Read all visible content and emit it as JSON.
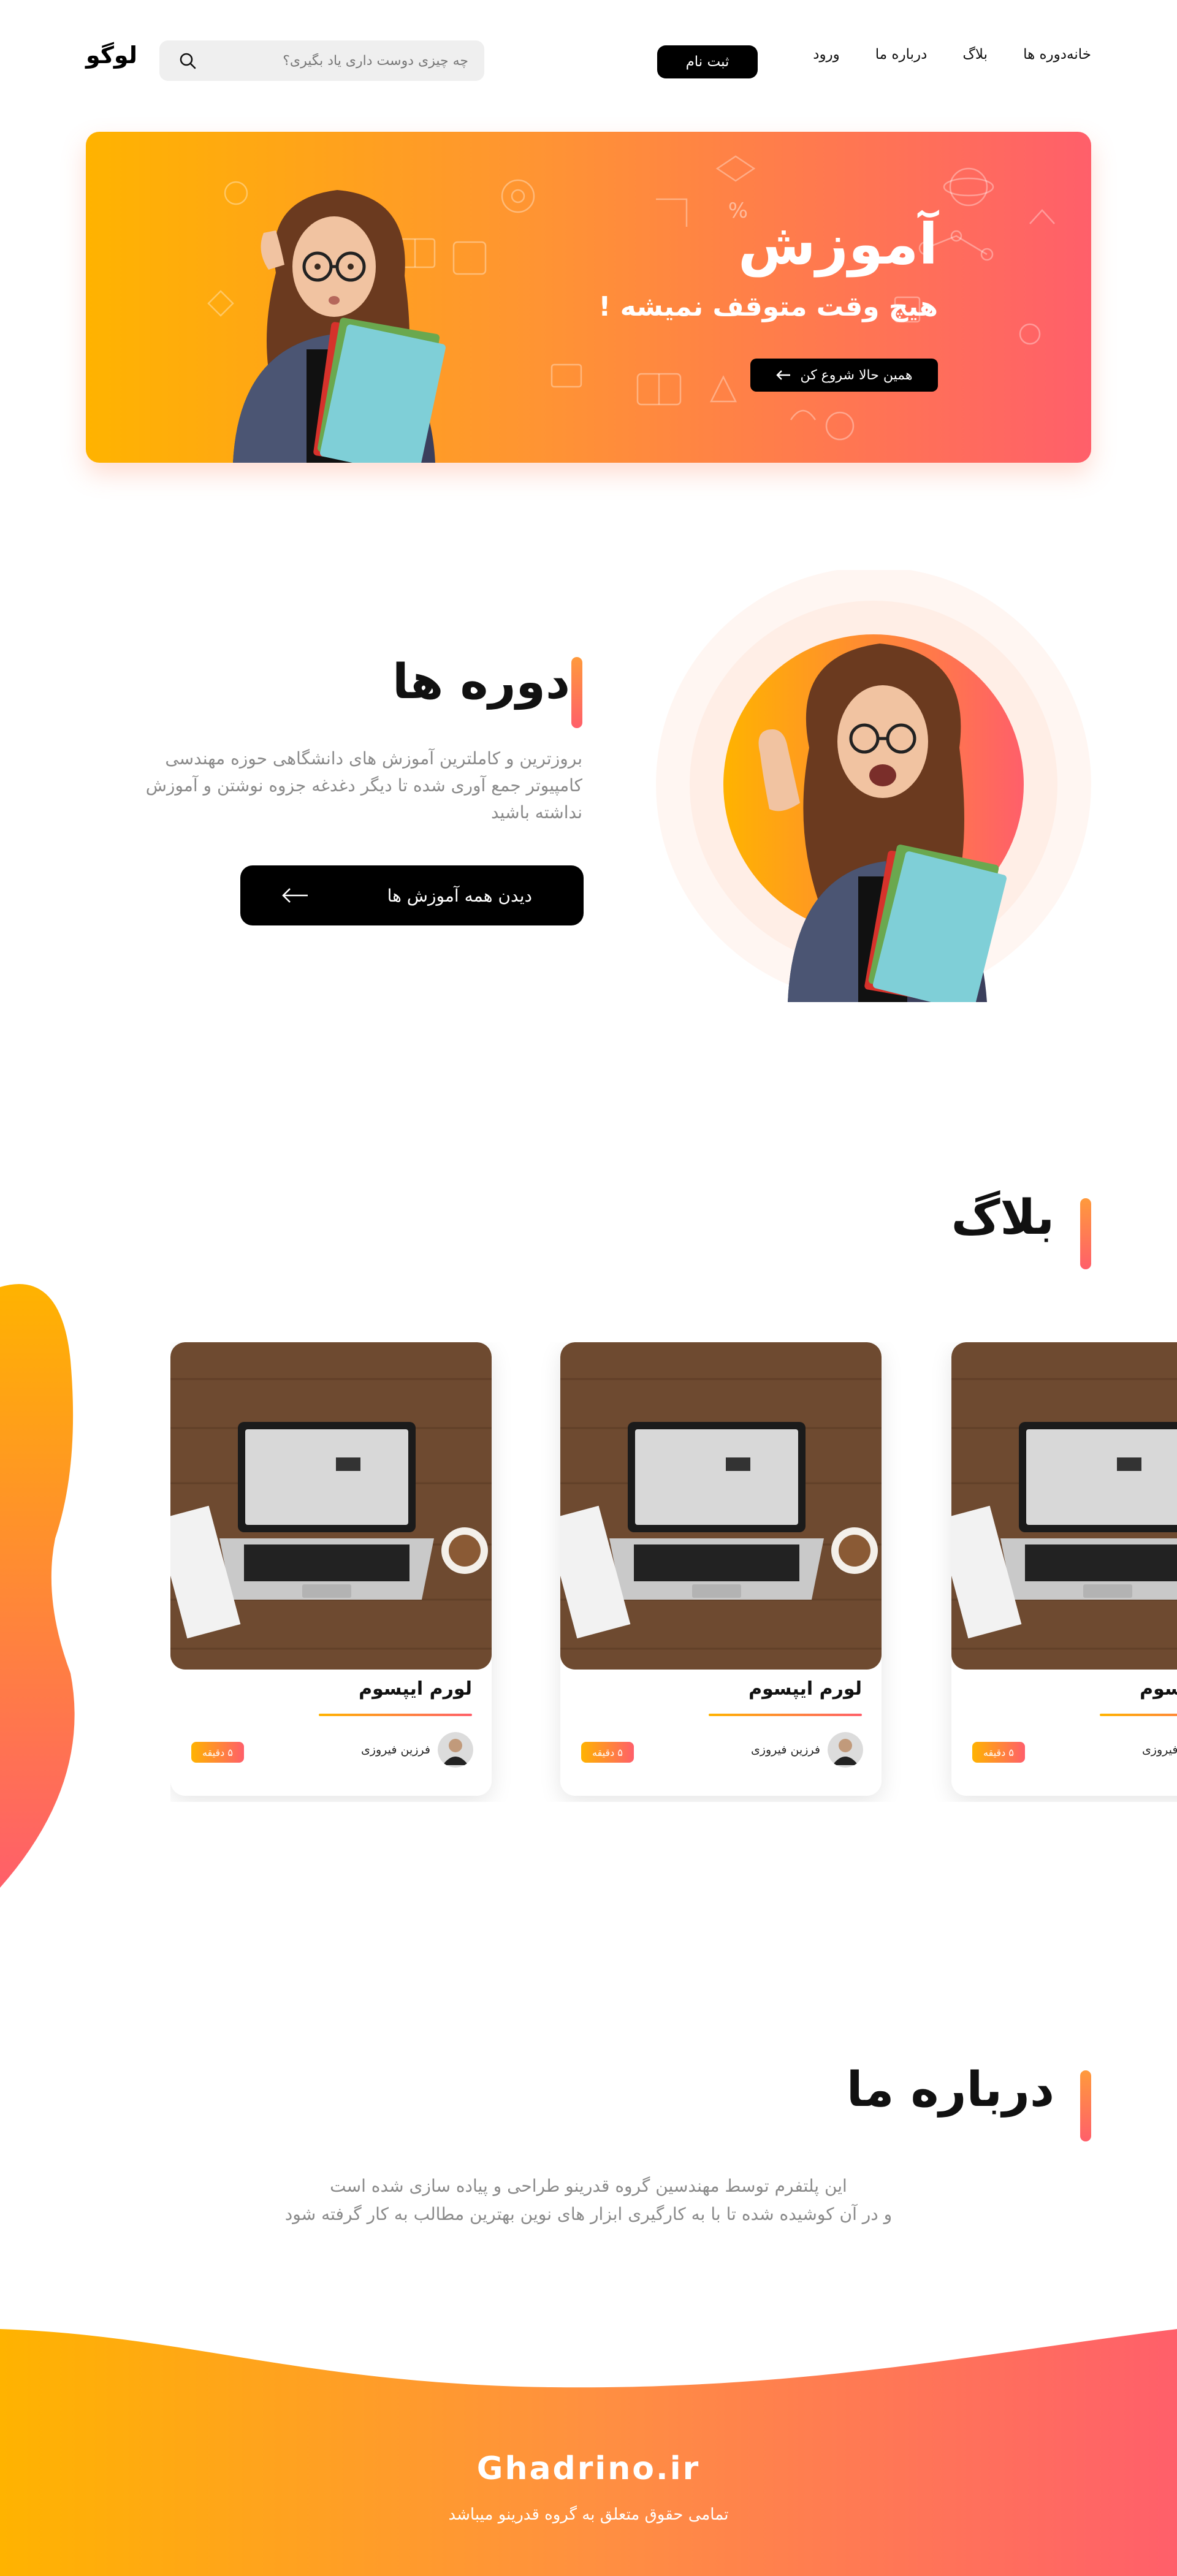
{
  "header": {
    "logo": "لوگو",
    "nav": [
      "خانه",
      "دوره ها",
      "بلاگ",
      "درباره ما",
      "ورود"
    ],
    "signup_label": "ثبت نام",
    "search_placeholder": "چه چیزی دوست داری یاد بگیری؟"
  },
  "hero": {
    "title": "آموزش",
    "subtitle": "هیچ وقت متوقف نمیشه !",
    "cta_label": "همین حالا شروع کن"
  },
  "courses": {
    "title": "دوره ها",
    "description": "بروزترین و کاملترین آموزش های دانشگاهی حوزه مهندسی کامپیوتر جمع آوری شده تا دیگر دغدغه جزوه نوشتن و آموزش نداشته باشید",
    "button_label": "دیدن همه آموزش ها"
  },
  "blog": {
    "title": "بلاگ",
    "cards": [
      {
        "title": "لورم ایپسوم",
        "author": "فرزین فیروزی",
        "badge": "۵ دقیقه"
      },
      {
        "title": "لورم ایپسوم",
        "author": "فرزین فیروزی",
        "badge": "۵ دقیقه"
      },
      {
        "title": "لورم ایپسوم",
        "author": "فرزین فیروزی",
        "badge": "۵ دقیقه"
      }
    ]
  },
  "about": {
    "title": "درباره ما",
    "line1": "این پلتفرم توسط مهندسین گروه قدرینو طراحی و پیاده سازی شده است",
    "line2": "و در آن کوشیده شده تا با به کارگیری ابزار های نوین بهترین مطالب به کار گرفته شود"
  },
  "footer": {
    "site": "Ghadrino.ir",
    "copyright": "تمامی حقوق متعلق به گروه قدرینو میباشد"
  },
  "colors": {
    "accent_start": "#ffb300",
    "accent_end": "#ff5f6a",
    "button": "#000000"
  }
}
